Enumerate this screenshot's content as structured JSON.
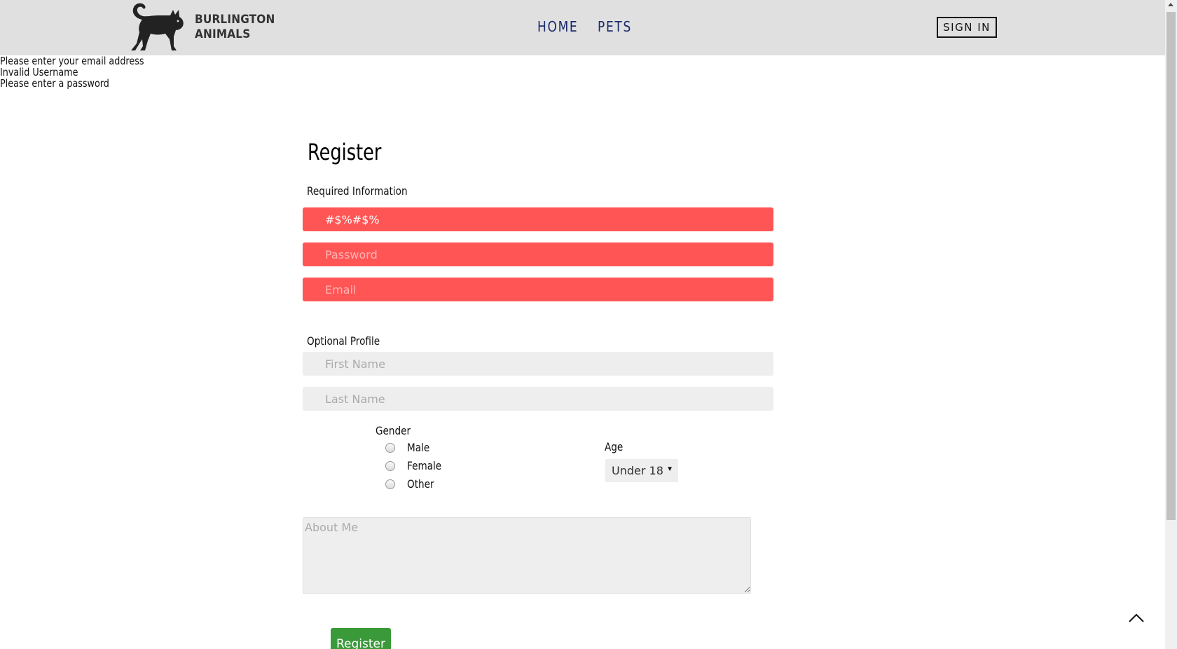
{
  "header": {
    "brand_line1": "BURLINGTON",
    "brand_line2": "ANIMALS",
    "logo_icon": "cat-icon",
    "nav": [
      {
        "label": "HOME"
      },
      {
        "label": "PETS"
      }
    ],
    "signin_label": "SIGN IN"
  },
  "errors": [
    "Please enter your email address",
    "Invalid Username",
    "Please enter a password"
  ],
  "form": {
    "title": "Register",
    "required_label": "Required Information",
    "username_value": "#$%#$%",
    "password_placeholder": "Password",
    "email_placeholder": "Email",
    "optional_label": "Optional Profile",
    "first_name_placeholder": "First Name",
    "last_name_placeholder": "Last Name",
    "gender_label": "Gender",
    "gender_options": [
      "Male",
      "Female",
      "Other"
    ],
    "age_label": "Age",
    "age_value": "Under 18",
    "about_placeholder": "About Me",
    "register_label": "Register"
  },
  "colors": {
    "header_bg": "#e0e0e0",
    "nav_text": "#1a2a6c",
    "invalid_field": "#ff5555",
    "input_bg": "#eeeeee",
    "register_button": "#3a9a3a"
  },
  "icons": {
    "scroll_to_top": "chevron-up-icon"
  }
}
